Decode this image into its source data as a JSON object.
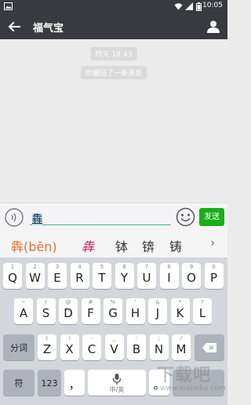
{
  "status_bar": {
    "time": "10:05"
  },
  "header": {
    "title": "福气宝"
  },
  "chat": {
    "messages": [
      {
        "text": "昨天 18:43"
      },
      {
        "text": "你撤回了一条消息"
      }
    ]
  },
  "composer": {
    "typed_text": "犇",
    "send_label": "发送"
  },
  "candidates": {
    "items": [
      "犇(bēn)",
      "犇",
      "钵",
      "锛",
      "铸"
    ],
    "more_label": "›"
  },
  "keyboard": {
    "row1": [
      {
        "main": "Q",
        "sub": "1"
      },
      {
        "main": "W",
        "sub": "2"
      },
      {
        "main": "E",
        "sub": "3"
      },
      {
        "main": "R",
        "sub": "4"
      },
      {
        "main": "T",
        "sub": "5"
      },
      {
        "main": "Y",
        "sub": "6"
      },
      {
        "main": "U",
        "sub": "7"
      },
      {
        "main": "I",
        "sub": "8"
      },
      {
        "main": "O",
        "sub": "9"
      },
      {
        "main": "P",
        "sub": "0"
      }
    ],
    "row2": [
      {
        "main": "A",
        "sub": "~"
      },
      {
        "main": "S",
        "sub": "!"
      },
      {
        "main": "D",
        "sub": "@"
      },
      {
        "main": "F",
        "sub": "#"
      },
      {
        "main": "G",
        "sub": "%"
      },
      {
        "main": "H",
        "sub": "'"
      },
      {
        "main": "J",
        "sub": "&"
      },
      {
        "main": "K",
        "sub": "*"
      },
      {
        "main": "L",
        "sub": "?"
      }
    ],
    "row3": [
      {
        "main": "Z",
        "sub": "("
      },
      {
        "main": "X",
        "sub": ")"
      },
      {
        "main": "C",
        "sub": "-"
      },
      {
        "main": "V",
        "sub": "_"
      },
      {
        "main": "B",
        "sub": ":"
      },
      {
        "main": "N",
        "sub": ";"
      },
      {
        "main": "M",
        "sub": "/"
      }
    ],
    "split_label": "分词",
    "symbol_label": "符",
    "num_label": "123",
    "comma_label": "，",
    "period_label": "。",
    "space_label": "中/英"
  },
  "watermark": {
    "text": "下载吧",
    "sub": "www.xiazaiba.com"
  }
}
